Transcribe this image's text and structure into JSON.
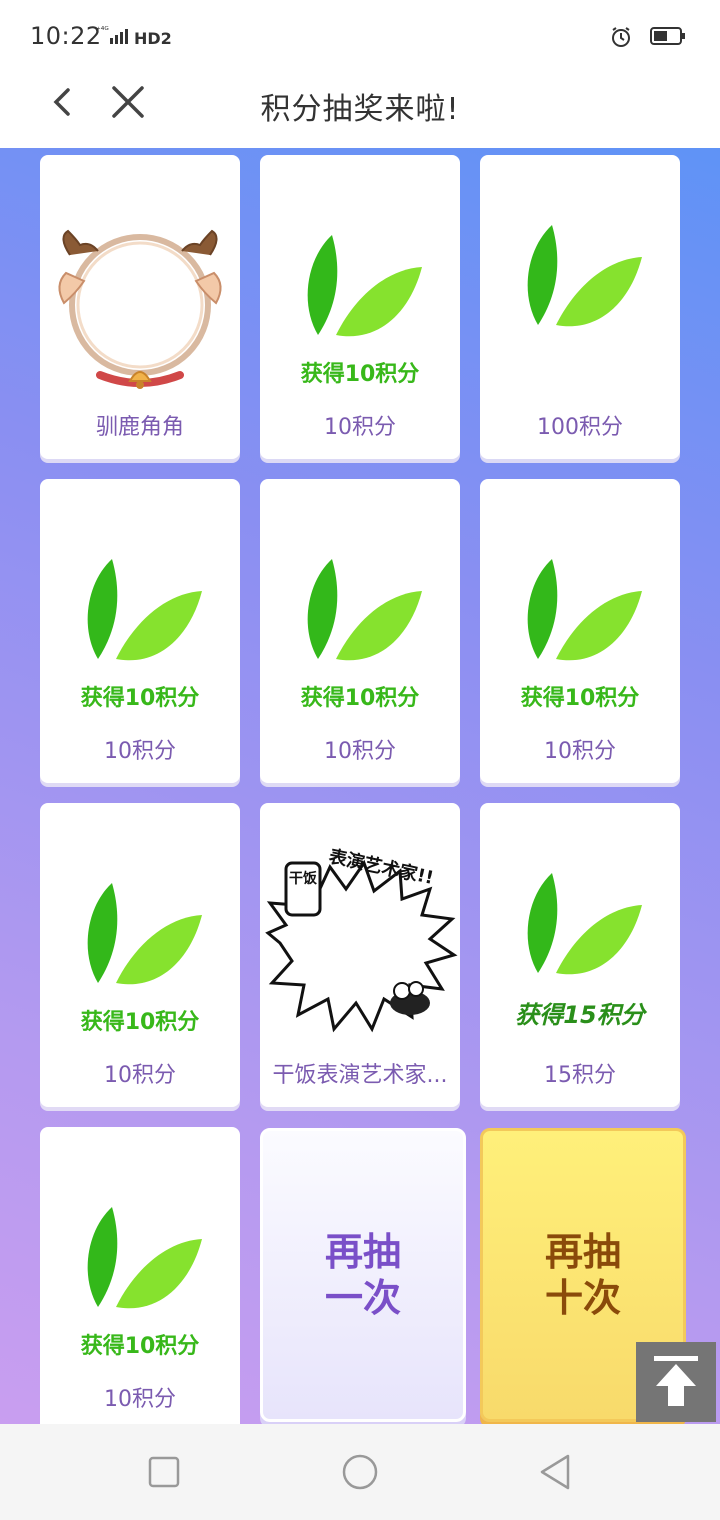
{
  "status_bar": {
    "time": "10:22",
    "network": "4G",
    "hd_badge": "HD2",
    "icons": [
      "signal-icon",
      "alarm-icon",
      "battery-icon"
    ]
  },
  "header": {
    "title": "积分抽奖来啦!",
    "icons": [
      "back-chevron-icon",
      "close-icon"
    ]
  },
  "prizes": [
    {
      "label": "驯鹿角角",
      "image": "reindeer-antler-frame",
      "image_caption": ""
    },
    {
      "label": "10积分",
      "image": "leaf-points",
      "image_caption": "获得10积分"
    },
    {
      "label": "100积分",
      "image": "leaf",
      "image_caption": ""
    },
    {
      "label": "10积分",
      "image": "leaf-points",
      "image_caption": "获得10积分"
    },
    {
      "label": "10积分",
      "image": "leaf-points",
      "image_caption": "获得10积分"
    },
    {
      "label": "10积分",
      "image": "leaf-points",
      "image_caption": "获得10积分"
    },
    {
      "label": "10积分",
      "image": "leaf-points",
      "image_caption": "获得10积分"
    },
    {
      "label": "干饭表演艺术家...",
      "image": "comic-frame",
      "image_caption": "表演艺术家!!",
      "image_badge": "干饭"
    },
    {
      "label": "15积分",
      "image": "leaf-points",
      "image_caption": "获得15积分"
    },
    {
      "label": "10积分",
      "image": "leaf-points",
      "image_caption": "获得10积分"
    }
  ],
  "buttons": {
    "draw_once_line1": "再抽",
    "draw_once_line2": "一次",
    "draw_ten_line1": "再抽",
    "draw_ten_line2": "十次",
    "scroll_top_icon": "arrow-up-to-top-icon"
  },
  "nav_bar": {
    "icons": [
      "recent-apps-square-icon",
      "home-circle-icon",
      "back-triangle-icon"
    ]
  },
  "colors": {
    "accent_purple": "#7b5bb0",
    "leaf_green": "#3cc21a",
    "caption_green": "#38b81a",
    "gold": "#f8da6b"
  }
}
